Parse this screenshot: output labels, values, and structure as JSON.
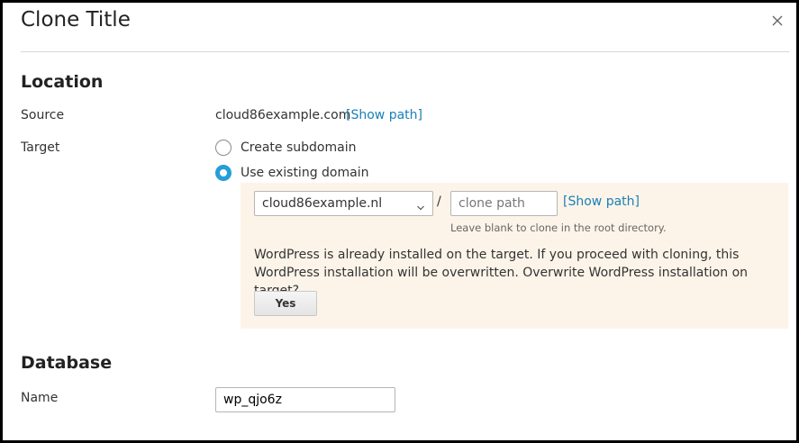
{
  "dialog": {
    "title": "Clone Title",
    "close_icon": "close-icon"
  },
  "location": {
    "heading": "Location",
    "source_label": "Source",
    "source_value": "cloud86example.com",
    "source_show_path": "[Show path]",
    "target_label": "Target",
    "options": [
      {
        "label": "Create subdomain",
        "checked": false
      },
      {
        "label": "Use existing domain",
        "checked": true
      }
    ],
    "domain_select": {
      "value": "cloud86example.nl",
      "arrow_icon": "chevron-down-icon"
    },
    "separator": "/",
    "clone_path": {
      "value": "",
      "placeholder": "clone path"
    },
    "target_show_path": "[Show path]",
    "hint": "Leave blank to clone in the root directory.",
    "warning": "WordPress is already installed on the target. If you proceed with cloning, this WordPress installation will be overwritten. Overwrite WordPress installation on target?",
    "confirm_button": "Yes",
    "panel_color": "#fdf4e9",
    "accent_color": "#259ed8",
    "link_color": "#1a80b6"
  },
  "database": {
    "heading": "Database",
    "name_label": "Name",
    "name_value": "wp_qjo6z"
  }
}
